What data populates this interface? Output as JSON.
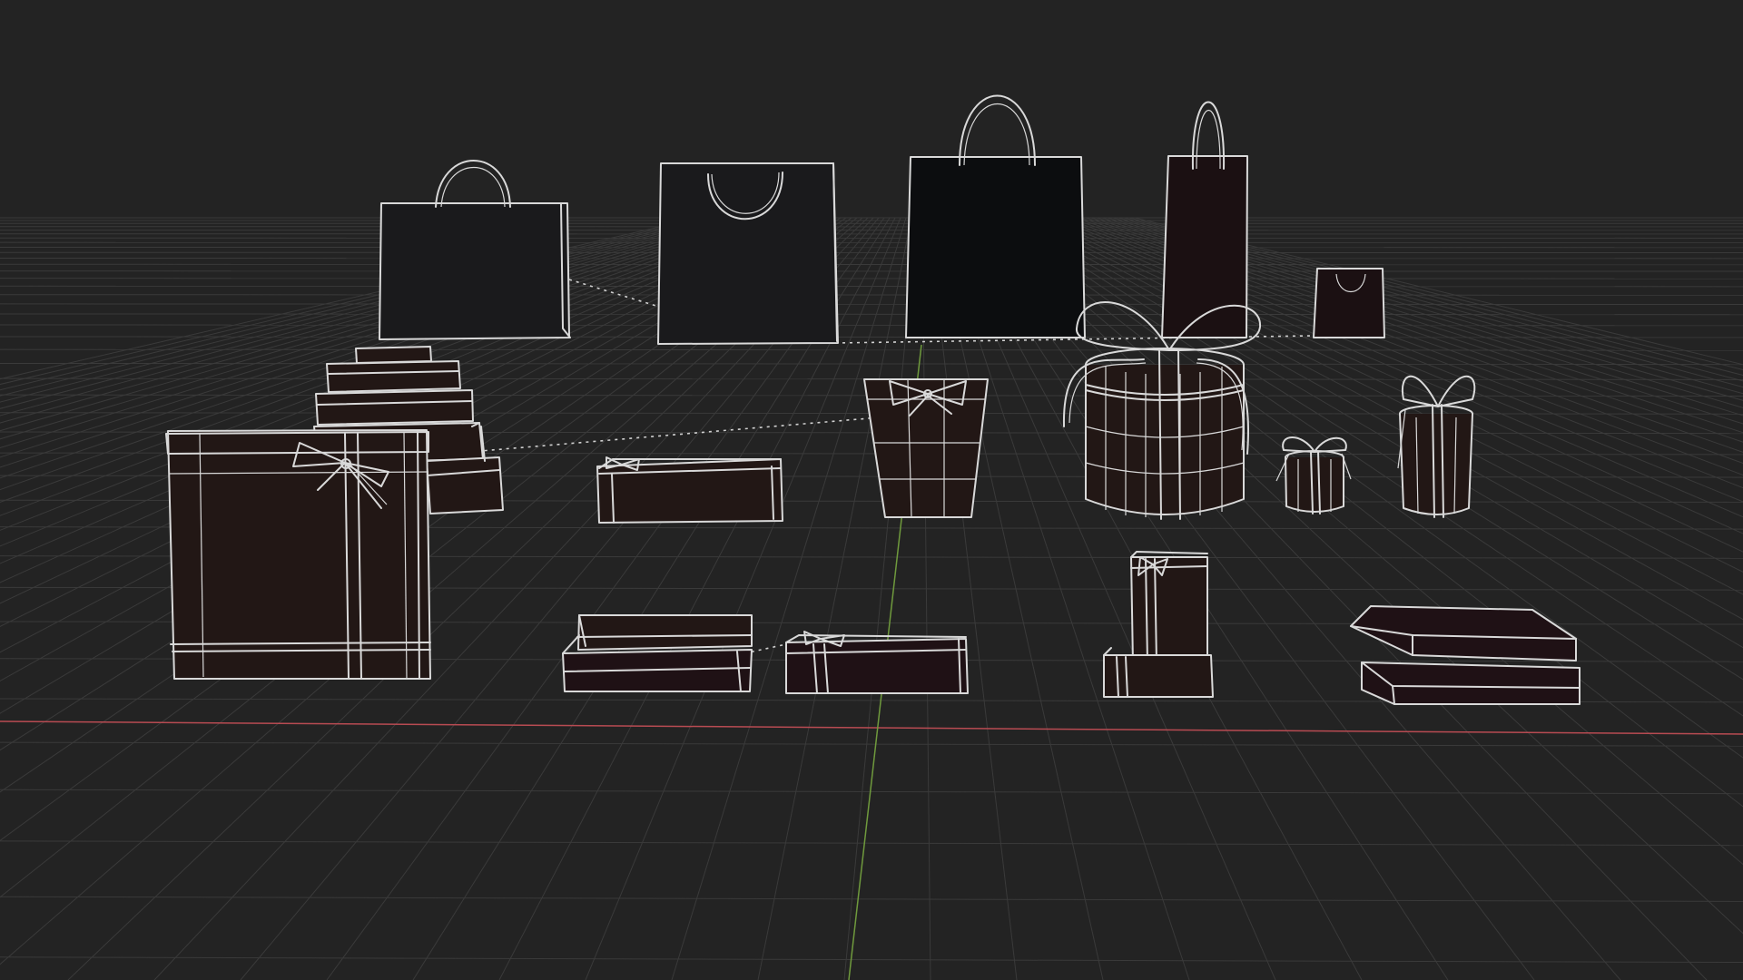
{
  "viewport": {
    "mode": "wireframe",
    "background": "#232323",
    "grid_color": "#3a3a3a",
    "x_axis_color": "#b84b52",
    "y_axis_color": "#6f9a3d",
    "wire_color": "#d9d9d9"
  },
  "materials": {
    "bag_dark": "#1a1a1c",
    "bag_black": "#0c0d0f",
    "bag_maroon": "#1b1012",
    "box_brown": "#221715",
    "box_maroon": "#1f1115"
  },
  "objects": [
    {
      "name": "shopping-bag-wide",
      "kind": "shopping bag"
    },
    {
      "name": "shopping-bag-square",
      "kind": "shopping bag"
    },
    {
      "name": "shopping-bag-black",
      "kind": "shopping bag"
    },
    {
      "name": "shopping-bag-tall",
      "kind": "shopping bag"
    },
    {
      "name": "shopping-bag-mini",
      "kind": "shopping bag"
    },
    {
      "name": "stacked-boxes",
      "kind": "gift box stack"
    },
    {
      "name": "large-gift-box",
      "kind": "gift box with bow"
    },
    {
      "name": "long-gift-box",
      "kind": "gift box"
    },
    {
      "name": "gift-bucket",
      "kind": "gift bucket with bow"
    },
    {
      "name": "round-hat-box",
      "kind": "round gift box with bow"
    },
    {
      "name": "small-round-gift",
      "kind": "round gift box with bow"
    },
    {
      "name": "tall-round-gift",
      "kind": "round gift box with bow"
    },
    {
      "name": "open-lid-box",
      "kind": "gift box with lid"
    },
    {
      "name": "ribbon-bar-box",
      "kind": "gift box with bow"
    },
    {
      "name": "tall-gift-set",
      "kind": "gift box set"
    },
    {
      "name": "flat-lid-box",
      "kind": "gift box with lid"
    }
  ]
}
